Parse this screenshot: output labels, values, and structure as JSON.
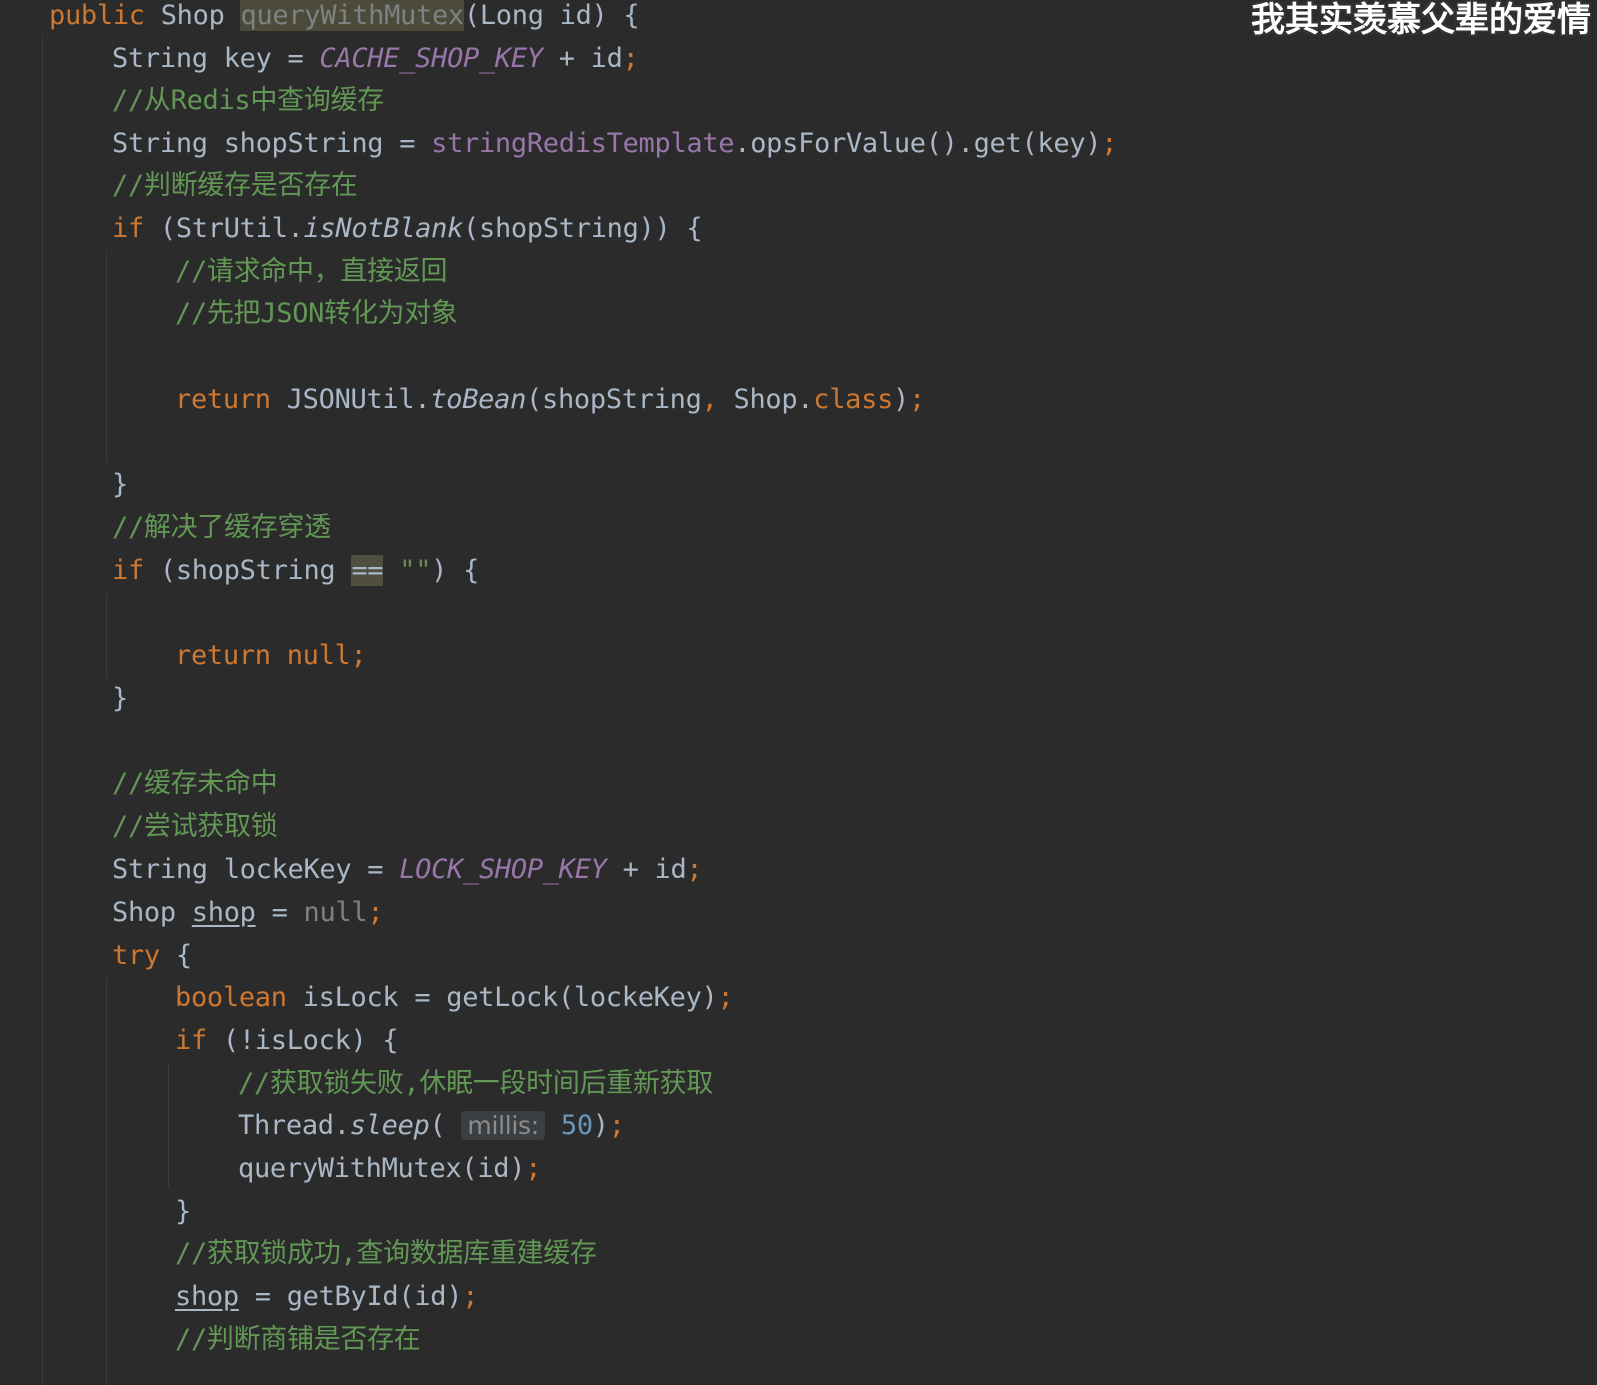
{
  "overlay": {
    "caption": "我其实羡慕父辈的爱情"
  },
  "editor": {
    "language": "java",
    "theme_colors": {
      "background": "#2b2b2b",
      "keyword": "#cc7832",
      "comment": "#629755",
      "field": "#9876aa",
      "number": "#6897bb",
      "default_text": "#a9b7c6"
    },
    "lines": [
      {
        "text": "public Shop queryWithMutex(Long id) {"
      },
      {
        "text": "String key = CACHE_SHOP_KEY + id;"
      },
      {
        "text": "//从Redis中查询缓存"
      },
      {
        "text": "String shopString = stringRedisTemplate.opsForValue().get(key);"
      },
      {
        "text": "//判断缓存是否存在"
      },
      {
        "text": "if (StrUtil.isNotBlank(shopString)) {"
      },
      {
        "text": "//请求命中，直接返回"
      },
      {
        "text": "//先把JSON转化为对象"
      },
      {
        "text": ""
      },
      {
        "text": "return JSONUtil.toBean(shopString, Shop.class);"
      },
      {
        "text": ""
      },
      {
        "text": "}"
      },
      {
        "text": "//解决了缓存穿透"
      },
      {
        "text": "if (shopString == \"\") {"
      },
      {
        "text": ""
      },
      {
        "text": "return null;"
      },
      {
        "text": "}"
      },
      {
        "text": ""
      },
      {
        "text": "//缓存未命中"
      },
      {
        "text": "//尝试获取锁"
      },
      {
        "text": "String lockeKey = LOCK_SHOP_KEY + id;"
      },
      {
        "text": "Shop shop = null;"
      },
      {
        "text": "try {"
      },
      {
        "text": "boolean isLock = getLock(lockeKey);"
      },
      {
        "text": "if (!isLock) {"
      },
      {
        "text": "//获取锁失败,休眠一段时间后重新获取"
      },
      {
        "text": "Thread.sleep( millis: 50);"
      },
      {
        "text": "queryWithMutex(id);"
      },
      {
        "text": "}"
      },
      {
        "text": "//获取锁成功,查询数据库重建缓存"
      },
      {
        "text": "shop = getById(id);"
      },
      {
        "text": "//判断商铺是否存在"
      }
    ]
  }
}
